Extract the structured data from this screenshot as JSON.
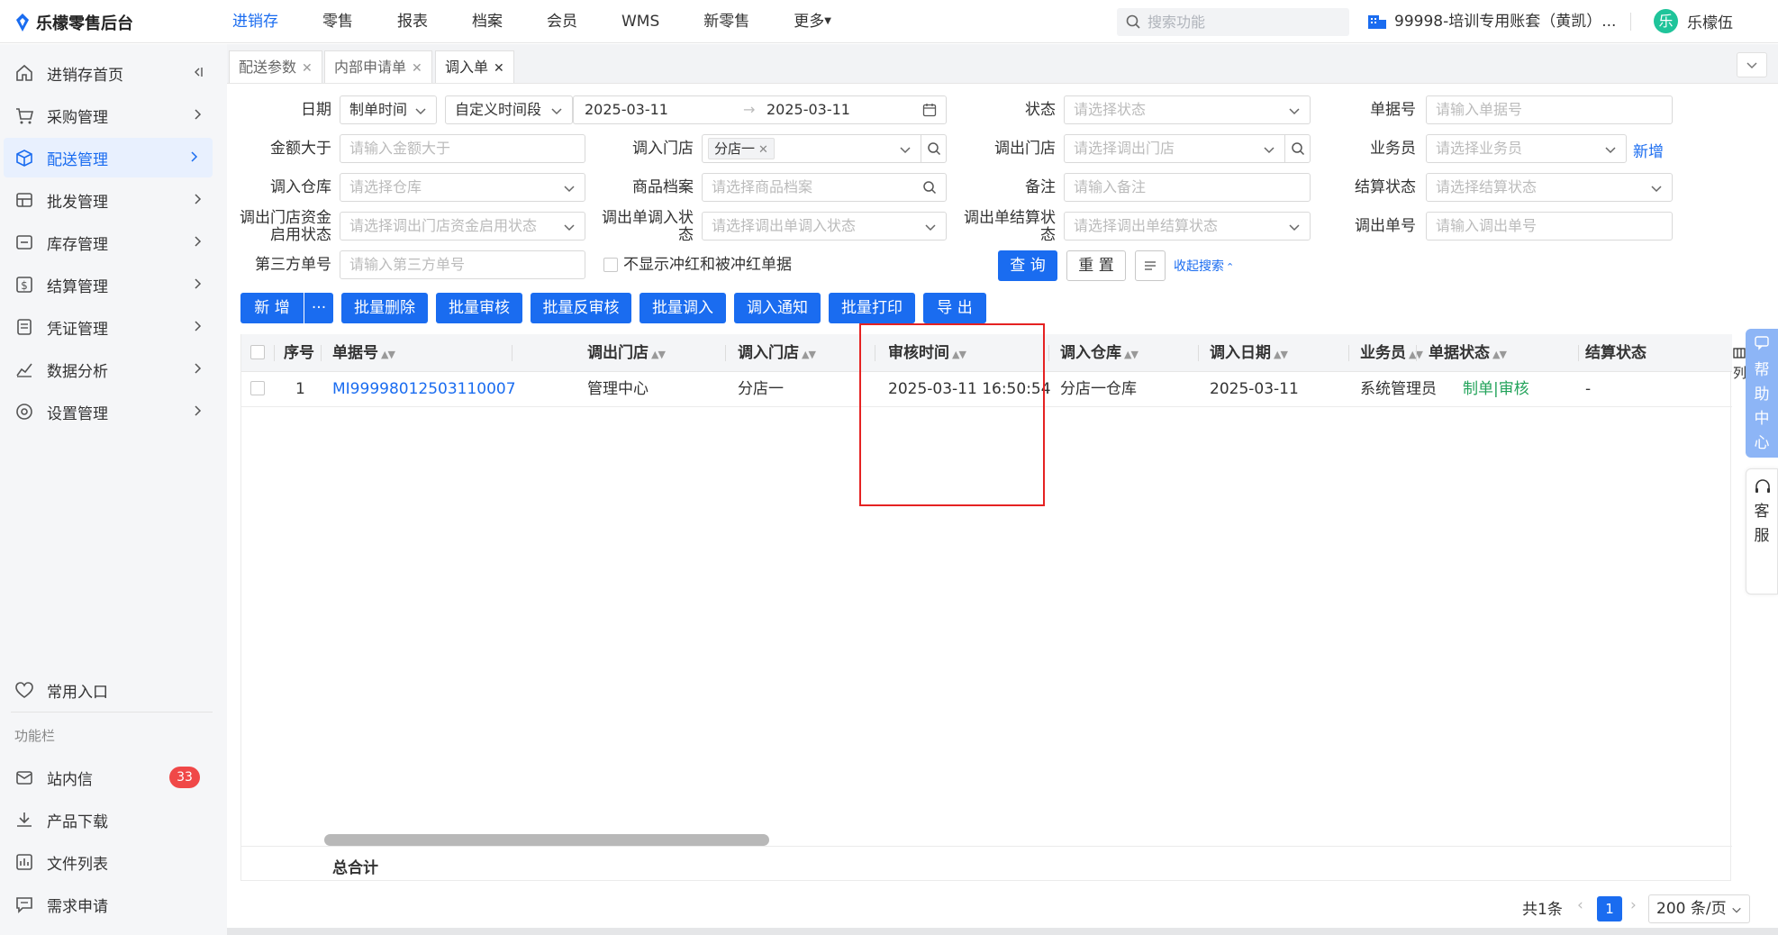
{
  "app": {
    "title": "乐檬零售后台"
  },
  "topnav": {
    "items": [
      "进销存",
      "零售",
      "报表",
      "档案",
      "会员",
      "WMS",
      "新零售",
      "更多"
    ],
    "active": "进销存"
  },
  "search": {
    "placeholder": "搜索功能"
  },
  "account": {
    "name": "99998-培训专用账套（黄凯）..."
  },
  "user": {
    "avatar": "乐",
    "name": "乐檬伍"
  },
  "sidebar": {
    "items": [
      "进销存首页",
      "采购管理",
      "配送管理",
      "批发管理",
      "库存管理",
      "结算管理",
      "凭证管理",
      "数据分析",
      "设置管理"
    ],
    "active": "配送管理",
    "common": "常用入口",
    "section": "功能栏",
    "func": [
      "站内信",
      "产品下载",
      "文件列表",
      "需求申请"
    ],
    "badge": "33"
  },
  "tabs": [
    "配送参数",
    "内部申请单",
    "调入单"
  ],
  "filters": {
    "date_label": "日期",
    "date_type": "制单时间",
    "date_range": "自定义时间段",
    "date_start": "2025-03-11",
    "date_end": "2025-03-11",
    "status_label": "状态",
    "status_ph": "请选择状态",
    "billno_label": "单据号",
    "billno_ph": "请输入单据号",
    "amount_label": "金额大于",
    "amount_ph": "请输入金额大于",
    "instore_label": "调入门店",
    "instore_tag": "分店一",
    "outstore_label": "调出门店",
    "outstore_ph": "请选择调出门店",
    "salesman_label": "业务员",
    "salesman_ph": "请选择业务员",
    "salesman_add": "新增",
    "inwh_label": "调入仓库",
    "inwh_ph": "请选择仓库",
    "goods_label": "商品档案",
    "goods_ph": "请选择商品档案",
    "remark_label": "备注",
    "remark_ph": "请输入备注",
    "settle_label": "结算状态",
    "settle_ph": "请选择结算状态",
    "fund_label_1": "调出门店资金",
    "fund_label_2": "启用状态",
    "fund_ph": "请选择调出门店资金启用状态",
    "outin_label_1": "调出单调入状",
    "outin_label_2": "态",
    "outin_ph": "请选择调出单调入状态",
    "outsettle_label_1": "调出单结算状",
    "outsettle_label_2": "态",
    "outsettle_ph": "请选择调出单结算状态",
    "outno_label": "调出单号",
    "outno_ph": "请输入调出单号",
    "third_label": "第三方单号",
    "third_ph": "请输入第三方单号",
    "hide_red": "不显示冲红和被冲红单据",
    "query": "查 询",
    "reset": "重 置",
    "collapse": "收起搜索"
  },
  "actions": [
    "新 增",
    "批量删除",
    "批量审核",
    "批量反审核",
    "批量调入",
    "调入通知",
    "批量打印",
    "导 出"
  ],
  "more": "···",
  "table": {
    "headers": [
      "序号",
      "单据号",
      "调出门店",
      "调入门店",
      "审核时间",
      "调入仓库",
      "调入日期",
      "业务员",
      "单据状态",
      "结算状态"
    ],
    "rows": [
      {
        "no": "1",
        "bill": "MI99998012503110007",
        "out": "管理中心",
        "in": "分店一",
        "audit": "2025-03-11 16:50:54",
        "wh": "分店一仓库",
        "date": "2025-03-11",
        "sales": "系统管理员",
        "status": "制单|审核",
        "settle": "-"
      }
    ],
    "total_label": "总合计",
    "column_setting": "列"
  },
  "pager": {
    "total": "共1条",
    "page": "1",
    "size": "200 条/页"
  },
  "side_help": {
    "help": [
      "帮",
      "助",
      "中",
      "心"
    ],
    "service": [
      "客",
      "服"
    ]
  },
  "colors": {
    "accent": "#1a6cf0",
    "status_green": "#22a35a",
    "highlight": "#e52222"
  }
}
